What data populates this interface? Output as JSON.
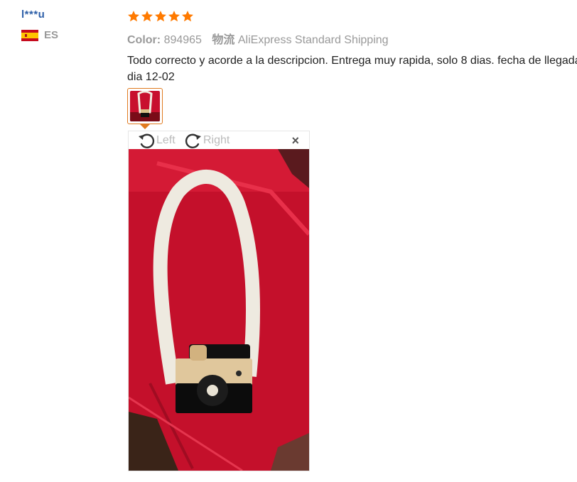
{
  "reviewer": {
    "name": "l***u",
    "country_code": "ES",
    "flag_icon": "spain-flag-icon"
  },
  "review": {
    "rating": 5,
    "rating_max": 5,
    "star_color": "#ff7a00",
    "color_label": "Color:",
    "color_value": "894965",
    "shipping_label": "物流",
    "shipping_value": "AliExpress Standard Shipping",
    "text_line1": "Todo correcto y acorde a la descripcion. Entrega muy rapida, solo 8 dias. fecha de llegada",
    "text_line2": "dia 12-02"
  },
  "image_viewer": {
    "rotate_left_label": "Left",
    "rotate_right_label": "Right",
    "close_symbol": "×",
    "rotate_left_icon": "rotate-left-icon",
    "rotate_right_icon": "rotate-right-icon"
  },
  "colors": {
    "reviewer_name": "#2d5fa8",
    "thumbnail_border": "#e07a1f"
  }
}
